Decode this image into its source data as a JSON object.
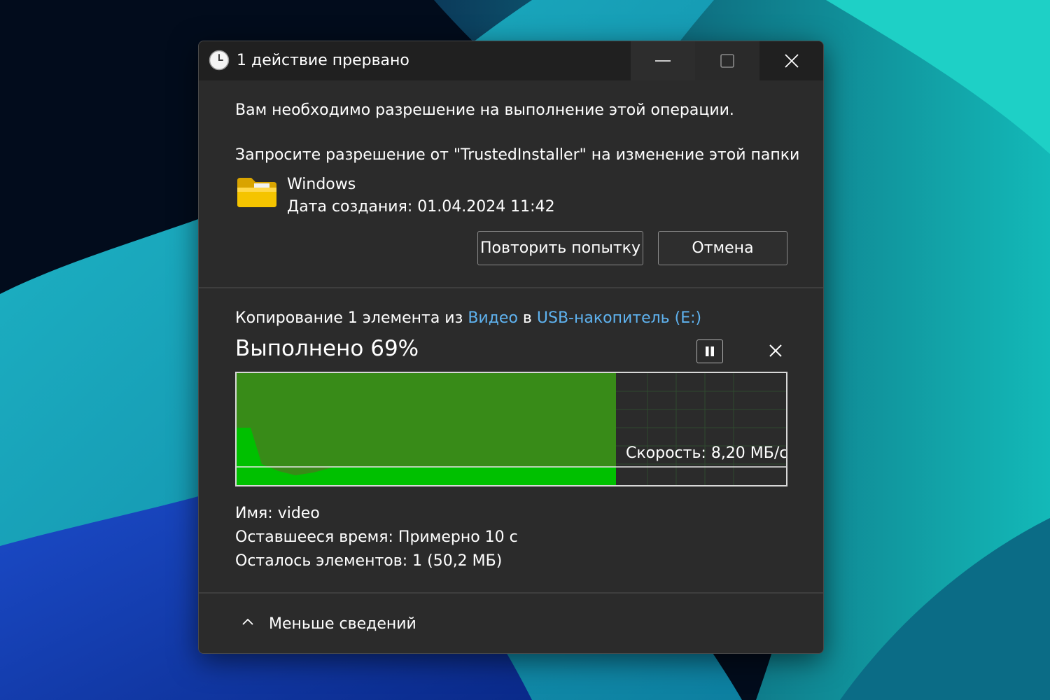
{
  "window": {
    "title": "1 действие прервано",
    "icon": "clock-icon",
    "controls": [
      "minimize-icon",
      "maximize-icon",
      "close-icon"
    ]
  },
  "permission": {
    "message": "Вам необходимо разрешение на выполнение этой операции.",
    "request": "Запросите разрешение от \"TrustedInstaller\" на изменение этой папки",
    "item_name": "Windows",
    "item_date": "Дата создания: 01.04.2024 11:42",
    "item_icon": "folder-icon",
    "retry_label": "Повторить попытку",
    "cancel_label": "Отмена"
  },
  "copy": {
    "prefix": "Копирование 1 элемента из ",
    "source": "Видео",
    "middle": " в ",
    "destination": "USB-накопитель (E:)",
    "progress_text": "Выполнено 69%",
    "progress_percent": 69,
    "speed": "Скорость: 8,20 МБ/с",
    "pause_icon": "pause-icon",
    "cancel_icon": "close-icon"
  },
  "details": {
    "name_label": "Имя:",
    "name_value": "video",
    "time_label": "Оставшееся время:",
    "time_value": "Примерно 10 с",
    "items_label": "Осталось элементов:",
    "items_value": "1 (50,2 МБ)"
  },
  "footer": {
    "label": "Меньше сведений",
    "icon": "chevron-up-icon"
  },
  "colors": {
    "dialog_bg": "#2b2b2b",
    "titlebar_bg": "#202020",
    "link": "#5fb3f0",
    "progress_fill": "#388b18",
    "speed_fill": "#00c000",
    "folder": "#f5c400"
  }
}
